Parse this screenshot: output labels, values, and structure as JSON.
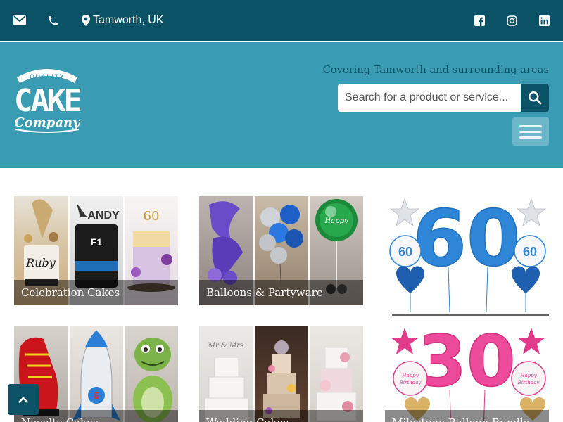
{
  "topbar": {
    "email_icon": "envelope-icon",
    "phone_icon": "phone-icon",
    "location": "Tamworth, UK",
    "social": [
      "facebook-icon",
      "instagram-icon",
      "linkedin-icon"
    ]
  },
  "header": {
    "logo_text": {
      "top": "QUALITY",
      "main": "CAKE",
      "sub": "Company"
    },
    "tagline": "Covering Tamworth and surrounding areas",
    "search": {
      "placeholder": "Search for a product or service..."
    }
  },
  "categories": [
    {
      "label": "Celebration Cakes"
    },
    {
      "label": "Balloons & Partyware"
    },
    {
      "label": "Novelty Cakes"
    },
    {
      "label": "Wedding Cakes"
    },
    {
      "label": "Milestone Balloon Bundle"
    }
  ],
  "balloons": [
    {
      "number": "60",
      "small_label": "60"
    },
    {
      "number": "30",
      "small_label": "Happy Birthday"
    }
  ],
  "colors": {
    "topbar": "#0b5266",
    "header": "#3a9cb3",
    "accent": "#0b5266"
  }
}
